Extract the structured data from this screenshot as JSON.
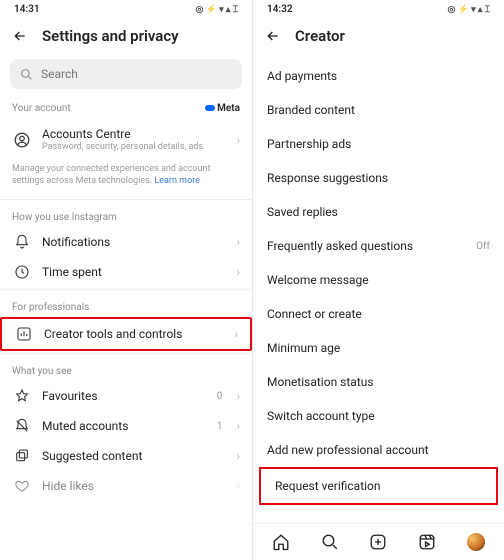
{
  "status": {
    "time_left": "14:31",
    "time_right": "14:32",
    "icons": "◎ ⚡ ▾ ▴ ⌶"
  },
  "left": {
    "title": "Settings and privacy",
    "search_placeholder": "Search",
    "account_label": "Your account",
    "meta_brand": "Meta",
    "accounts": {
      "title": "Accounts Centre",
      "sub": "Password, security, personal details, ads"
    },
    "fineprint": "Manage your connected experiences and account settings across Meta technologies. ",
    "learn_more": "Learn more",
    "how_label": "How you use Instagram",
    "notifications": "Notifications",
    "time_spent": "Time spent",
    "prof_label": "For professionals",
    "creator_tools": "Creator tools and controls",
    "see_label": "What you see",
    "favourites": "Favourites",
    "fav_count": "0",
    "muted": "Muted accounts",
    "muted_count": "1",
    "suggested": "Suggested content",
    "hide_likes": "Hide likes"
  },
  "right": {
    "title": "Creator",
    "items": [
      "Ad payments",
      "Branded content",
      "Partnership ads",
      "Response suggestions",
      "Saved replies",
      "Frequently asked questions",
      "Welcome message",
      "Connect or create",
      "Minimum age",
      "Monetisation status",
      "Switch account type",
      "Add new professional account",
      "Request verification"
    ],
    "faq_state": "Off"
  }
}
